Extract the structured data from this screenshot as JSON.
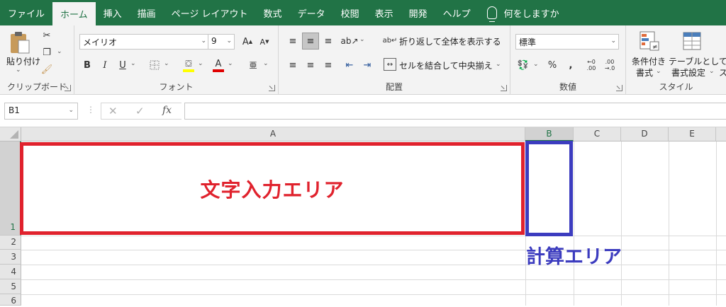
{
  "tabs": [
    "ファイル",
    "ホーム",
    "挿入",
    "描画",
    "ページ レイアウト",
    "数式",
    "データ",
    "校閲",
    "表示",
    "開発",
    "ヘルプ"
  ],
  "tell_me": "何をしますか",
  "clipboard": {
    "paste": "貼り付け",
    "label": "クリップボード"
  },
  "font": {
    "name": "メイリオ",
    "size": "9",
    "label": "フォント"
  },
  "alignment": {
    "wrap": "折り返して全体を表示する",
    "merge": "セルを結合して中央揃え",
    "label": "配置"
  },
  "number": {
    "format": "標準",
    "label": "数値"
  },
  "styles": {
    "cond_line1": "条件付き",
    "cond_line2": "書式",
    "table_line1": "テーブルとして",
    "table_line2": "書式設定",
    "partial": "ス",
    "label": "スタイル"
  },
  "formula_bar": {
    "name_box": "B1",
    "fx": "fx",
    "content": ""
  },
  "columns": [
    "A",
    "B",
    "C",
    "D",
    "E"
  ],
  "rows": [
    "1",
    "2",
    "3",
    "4",
    "5",
    "6"
  ],
  "annotations": {
    "input_area": "文字入力エリア",
    "calc_area": "計算エリア"
  },
  "colors": {
    "ribbon_green": "#217346",
    "input_box": "#e0222d",
    "calc_box": "#3c3cbf"
  }
}
